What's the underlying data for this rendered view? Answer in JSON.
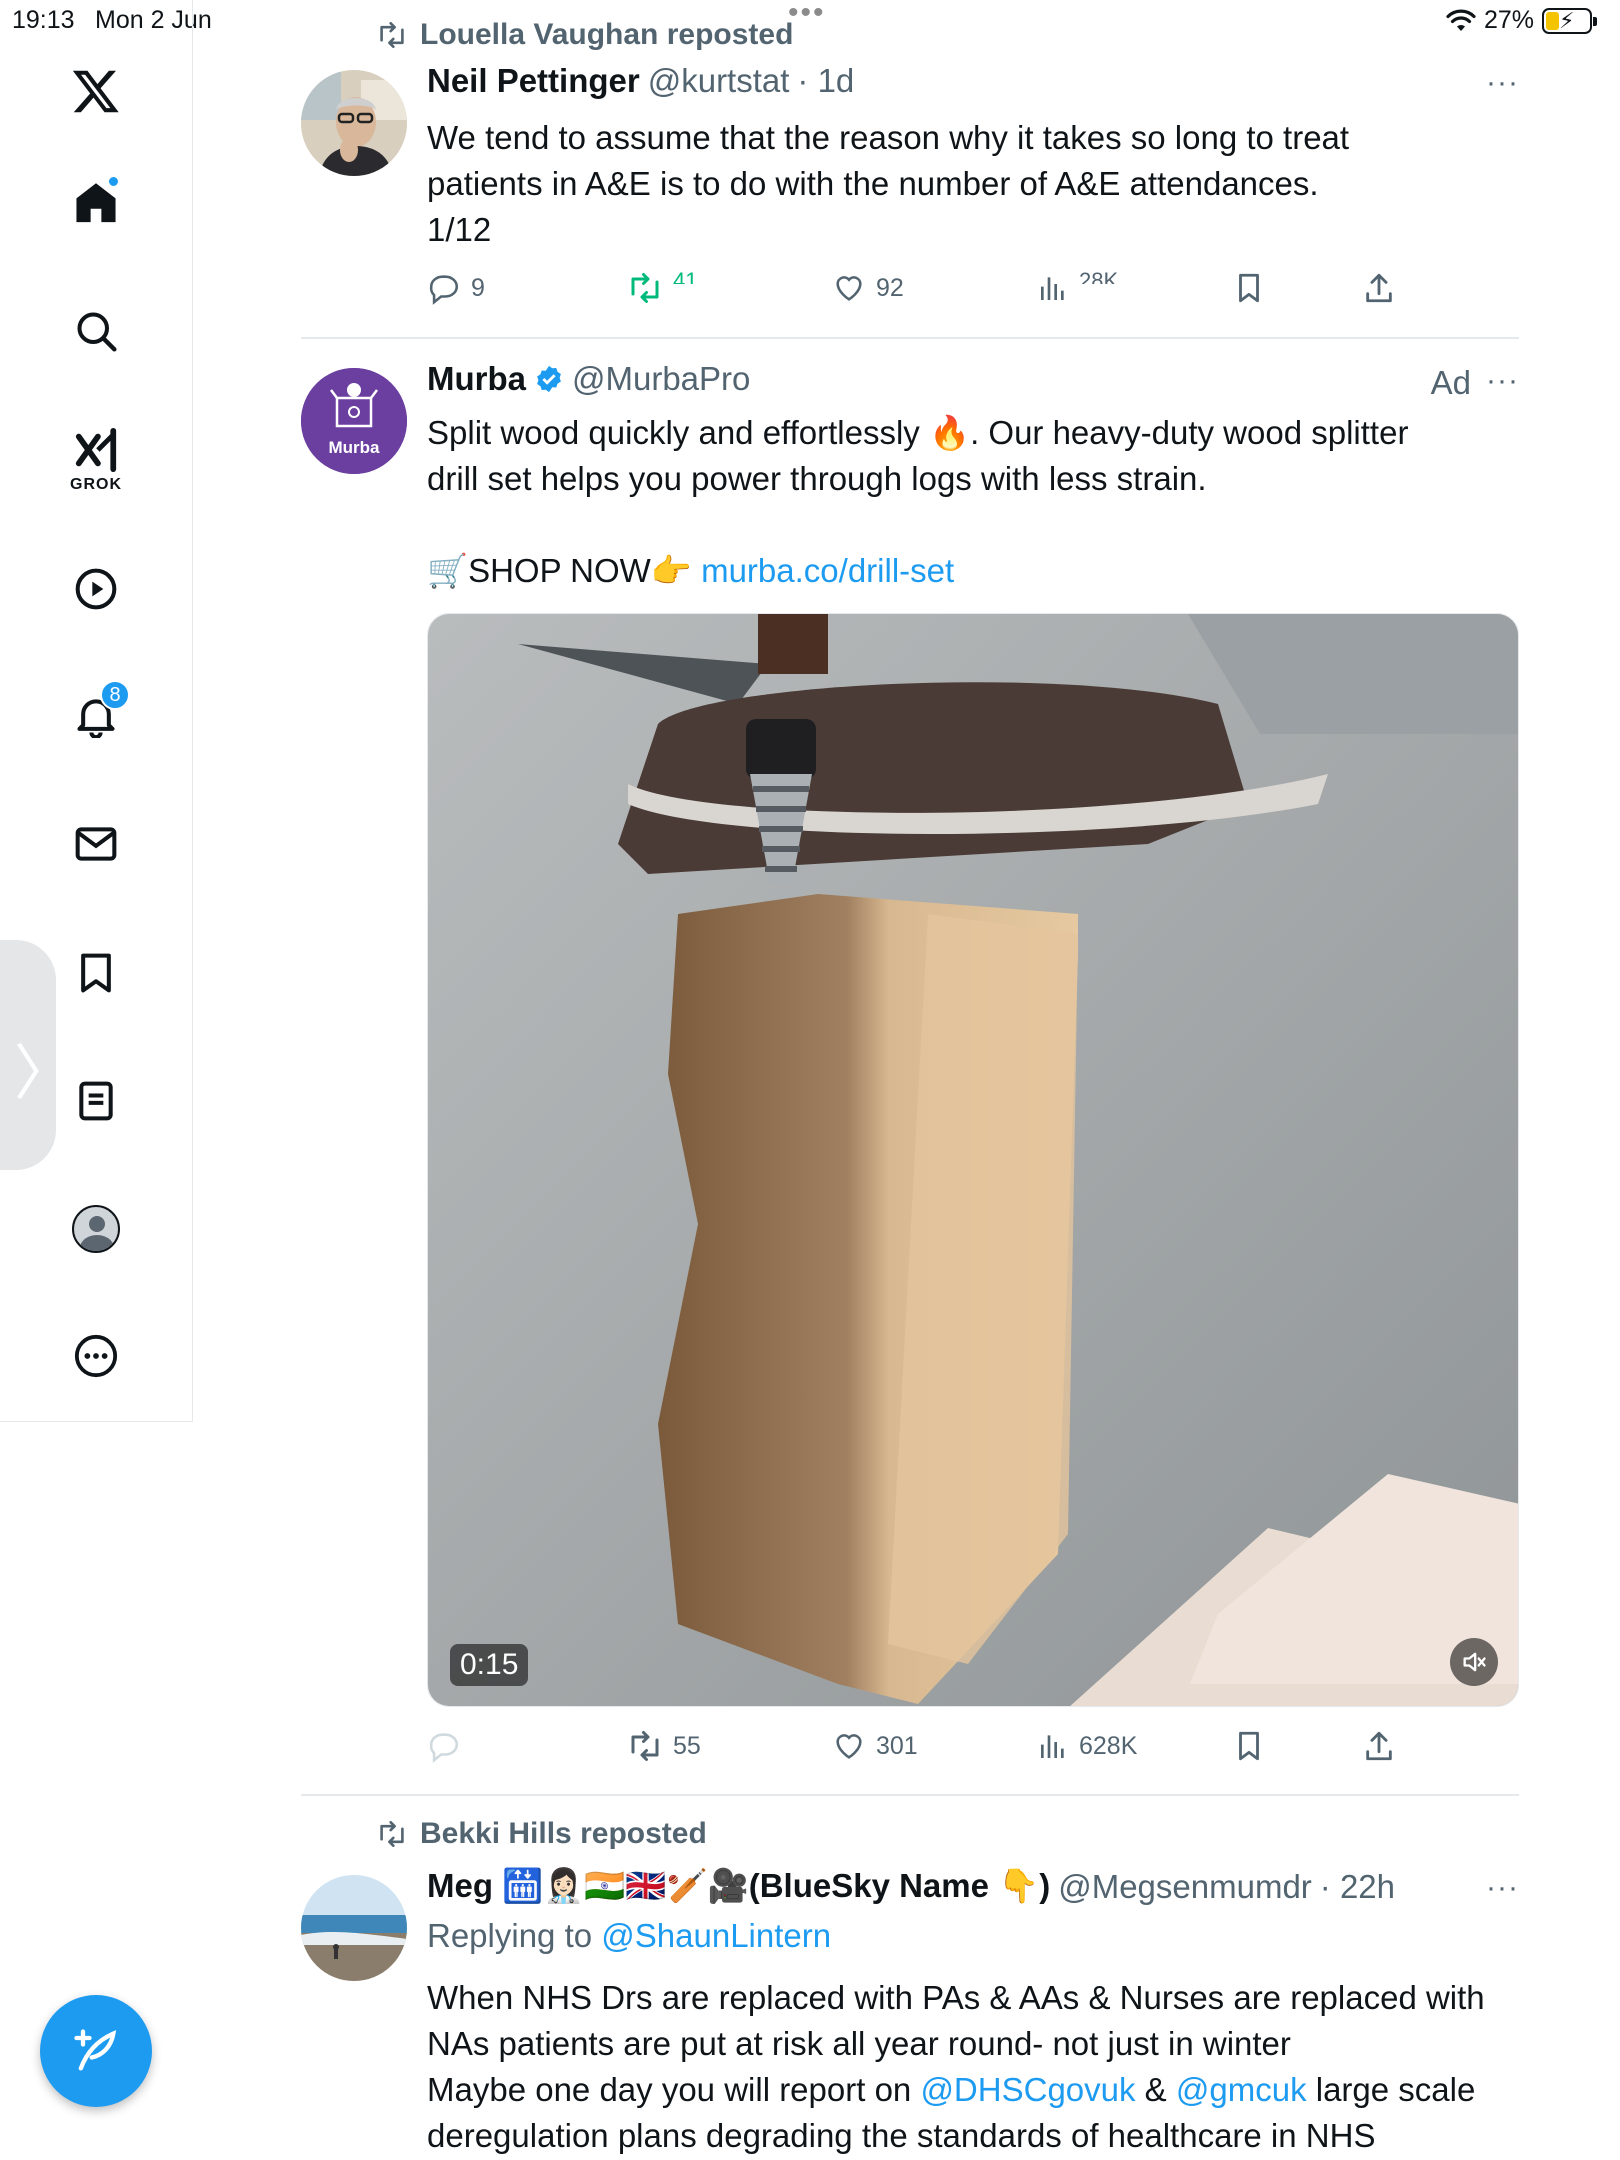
{
  "status_bar": {
    "time": "19:13",
    "date": "Mon 2 Jun",
    "dots": "•••",
    "battery": "27%"
  },
  "sidebar": {
    "items": [
      {
        "icon": "x-logo-icon"
      },
      {
        "icon": "home-icon",
        "has_dot": true
      },
      {
        "icon": "search-icon"
      },
      {
        "icon": "grok-icon",
        "label": "GROK"
      },
      {
        "icon": "video-play-icon"
      },
      {
        "icon": "notifications-bell-icon",
        "badge": "8"
      },
      {
        "icon": "messages-envelope-icon"
      },
      {
        "icon": "bookmarks-icon"
      },
      {
        "icon": "articles-icon"
      },
      {
        "icon": "profile-avatar-icon"
      },
      {
        "icon": "more-circle-icon"
      }
    ],
    "compose_icon": "compose-feather-icon"
  },
  "posts": [
    {
      "repost_by": "Louella Vaughan reposted",
      "name": "Neil Pettinger",
      "handle": "@kurtstat",
      "time": "· 1d",
      "more": "···",
      "text_lines": [
        "We tend to assume that the reason why it takes so long to treat",
        "patients in A&E is to do with the number of A&E attendances.",
        "1/12"
      ],
      "actions": {
        "replies": "9",
        "reposts": "41",
        "likes": "92",
        "views": "28K"
      }
    },
    {
      "name": "Murba",
      "handle": "@MurbaPro",
      "ad_label": "Ad",
      "more": "···",
      "avatar_text": "Murba",
      "text_line1": "Split wood quickly and effortlessly 🔥. Our heavy-duty wood splitter",
      "text_line2": "drill set helps you power through logs with less strain.",
      "shop_prefix": "🛒SHOP NOW👉 ",
      "link": "murba.co/drill-set",
      "video_time": "0:15",
      "actions": {
        "reposts": "55",
        "likes": "301",
        "views": "628K"
      }
    },
    {
      "repost_by": "Bekki Hills reposted",
      "name": "Meg 🛗👩🏻‍⚕️🇮🇳🇬🇧🏏🎥(BlueSky Name 👇)",
      "handle": "@Megsenmumdr",
      "time": "· 22h",
      "more": "···",
      "replying_prefix": "Replying to ",
      "replying_handle": "@ShaunLintern",
      "text_line1": "When NHS Drs are replaced with PAs & AAs & Nurses are replaced with",
      "text_line2": "NAs patients are put at risk all year round- not just in winter",
      "text_line3_prefix": "Maybe one day you will report on ",
      "mention1": "@DHSCgovuk",
      "amp": " & ",
      "mention2": "@gmcuk",
      "text_line3_suffix": " large scale",
      "text_line4": "deregulation plans degrading the standards of healthcare in NHS"
    }
  ],
  "colors": {
    "accent": "#1d9bf0",
    "repost_green": "#00ba7c",
    "secondary_text": "#536471",
    "murba_purple": "#6b3fa0"
  }
}
